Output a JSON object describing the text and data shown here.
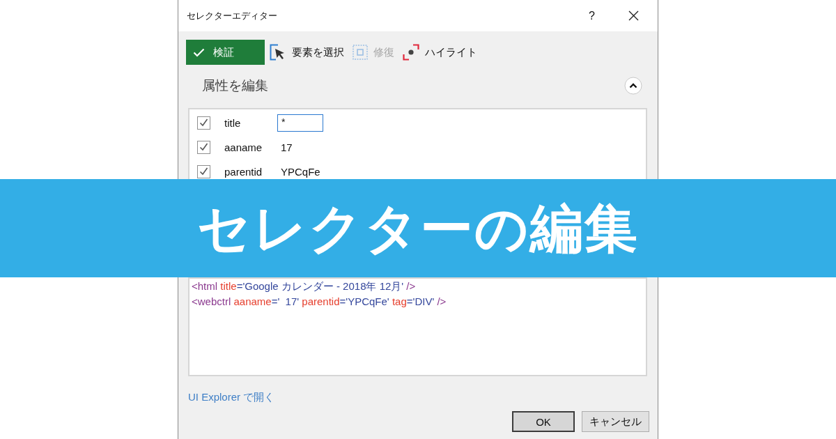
{
  "window": {
    "title": "セレクターエディター",
    "help": "?"
  },
  "toolbar": [
    {
      "kind": "validate",
      "label": "検証",
      "disabled": false
    },
    {
      "kind": "select",
      "label": "要素を選択",
      "disabled": false
    },
    {
      "kind": "repair",
      "label": "修復",
      "disabled": true
    },
    {
      "kind": "highlight",
      "label": "ハイライト",
      "disabled": false
    }
  ],
  "attributes_section": {
    "title": "属性を編集",
    "expanded": true,
    "attributes": [
      {
        "kind": "input",
        "name": "title",
        "value": "*",
        "checked": true
      },
      {
        "kind": "text",
        "name": "aaname",
        "value": "17",
        "checked": true
      },
      {
        "kind": "text",
        "name": "parentid",
        "value": "YPCqFe",
        "checked": true
      }
    ]
  },
  "selector_editor": {
    "lines": [
      [
        {
          "kind": "tag",
          "text": "<html"
        },
        {
          "kind": "attr",
          "text": " title"
        },
        {
          "kind": "value",
          "text": "='Google カレンダー - 2018年 12月'"
        },
        {
          "kind": "tag",
          "text": " />"
        }
      ],
      [
        {
          "kind": "tag",
          "text": "<webctrl"
        },
        {
          "kind": "attr",
          "text": " aaname"
        },
        {
          "kind": "value",
          "text": "='  17'"
        },
        {
          "kind": "attr",
          "text": " parentid"
        },
        {
          "kind": "value",
          "text": "='YPCqFe'"
        },
        {
          "kind": "attr",
          "text": " tag"
        },
        {
          "kind": "value",
          "text": "='DIV'"
        },
        {
          "kind": "tag",
          "text": " />"
        }
      ]
    ]
  },
  "link": "UI Explorer で開く",
  "buttons": [
    {
      "label": "OK",
      "default": true
    },
    {
      "label": "キャンセル",
      "default": false
    }
  ],
  "banner": {
    "title": "セレクターの編集"
  }
}
